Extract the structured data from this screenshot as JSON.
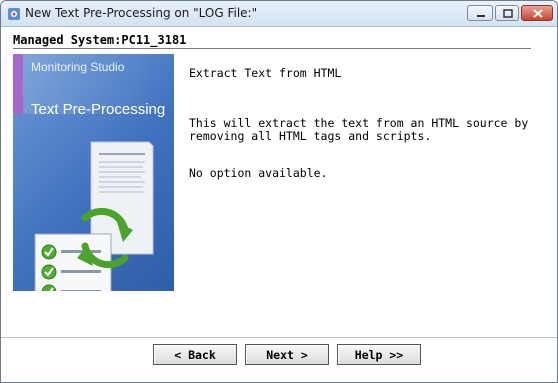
{
  "window": {
    "title": "New Text Pre-Processing on \"LOG File:\"",
    "accent_color": "#3f71bf",
    "close_color": "#c8452e"
  },
  "header": {
    "managed_system": "Managed System:PC11_3181"
  },
  "side_panel": {
    "brand": "Monitoring Studio",
    "product": "Text Pre-Processing",
    "icon": "document-checklist-refresh-icon"
  },
  "content": {
    "title": "Extract Text from HTML",
    "description": "This will extract the text from an HTML source by removing all HTML tags and scripts.",
    "options": "No option available."
  },
  "buttons": {
    "back": "< Back",
    "next": "Next >",
    "help": "Help >>"
  }
}
